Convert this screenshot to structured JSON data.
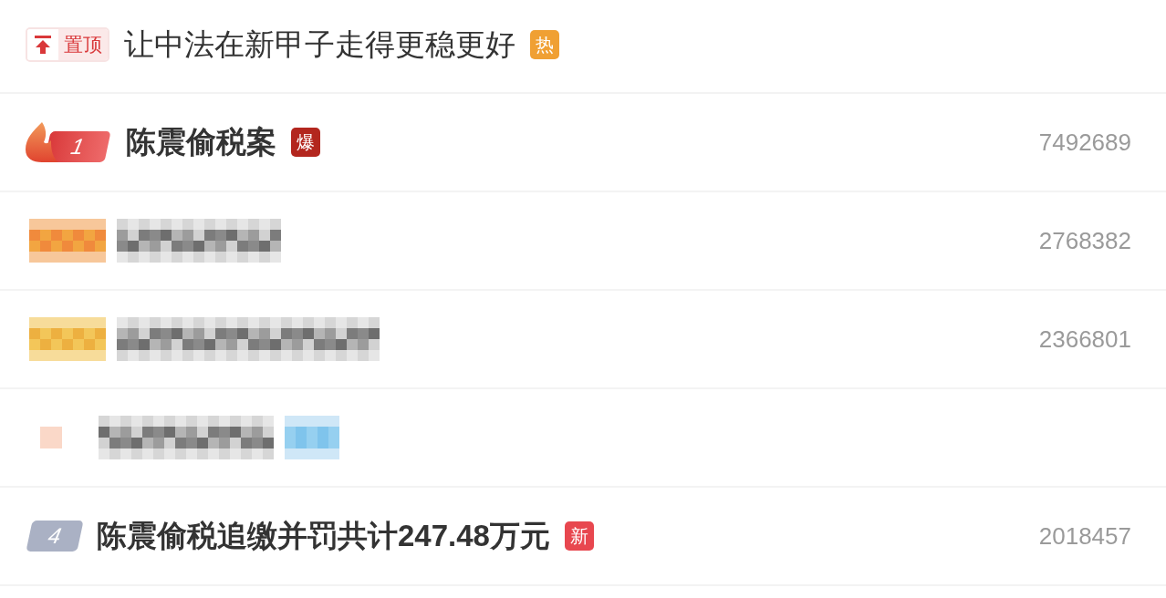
{
  "items": [
    {
      "kind": "pinned",
      "badge": "置顶",
      "title": "让中法在新甲子走得更稳更好",
      "tag": {
        "text": "热",
        "color": "#f0a033"
      }
    },
    {
      "kind": "ranked",
      "rank": "1",
      "top": true,
      "title": "陈震偷税案",
      "tag": {
        "text": "爆",
        "color": "#b3261e"
      },
      "count": "7492689"
    },
    {
      "kind": "redacted",
      "count": "2768382"
    },
    {
      "kind": "redacted",
      "count": "2366801"
    },
    {
      "kind": "redacted"
    },
    {
      "kind": "ranked",
      "rank": "4",
      "top": false,
      "title": "陈震偷税追缴并罚共计247.48万元",
      "tag": {
        "text": "新",
        "color": "#e8474f"
      },
      "count": "2018457"
    }
  ]
}
